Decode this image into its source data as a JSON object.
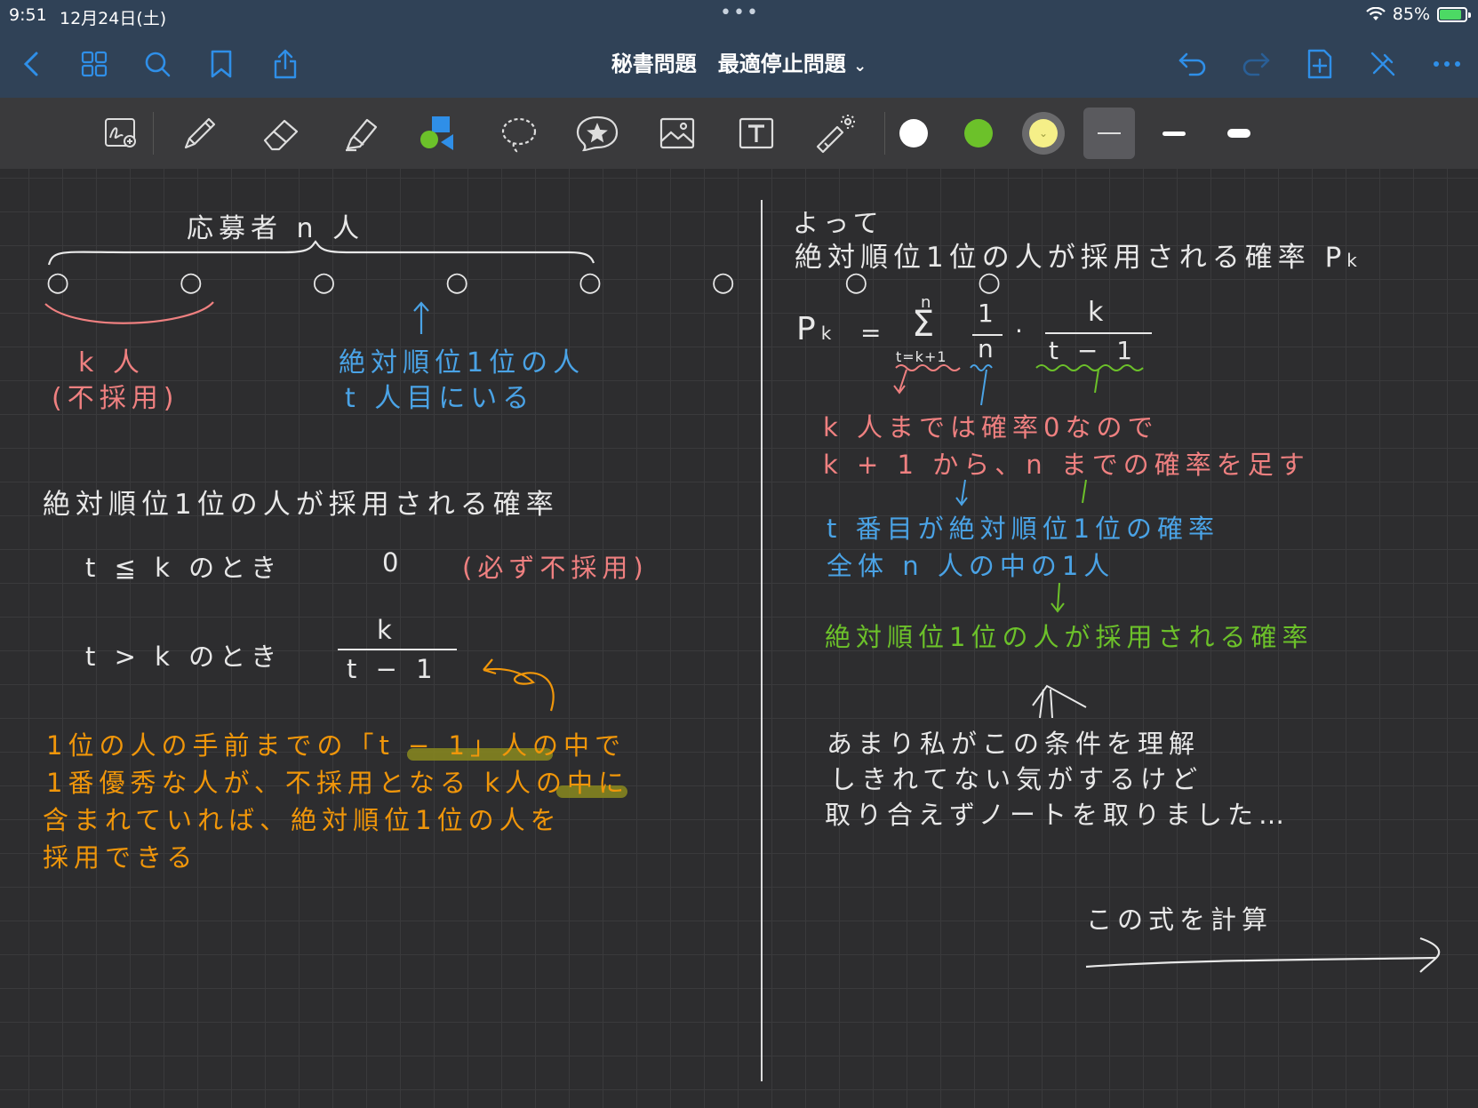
{
  "status": {
    "time": "9:51",
    "date": "12月24日(土)",
    "battery": "85%"
  },
  "nav": {
    "title": "秘書問題　最適停止問題",
    "title_chevron": "⌄"
  },
  "toolbar": {
    "colors": [
      "#ffffff",
      "#6cc12a",
      "#f5ef88"
    ]
  },
  "note": {
    "left": {
      "applicants": "応募者 n 人",
      "circles": "○ ○ ○ ○ ○ ○ ○ ○",
      "k_people": "k 人",
      "not_hired": "(不採用)",
      "best_person": "絶対順位1位の人",
      "tth": "t 人目にいる",
      "prob_heading": "絶対順位1位の人が採用される確率",
      "case1": "t ≦ k のとき",
      "case1_value": "0",
      "case1_note": "(必ず不採用)",
      "case2": "t > k のとき",
      "case2_num": "k",
      "case2_den": "t − 1",
      "explain": [
        "1位の人の手前までの「t − 1」人の中で",
        "1番優秀な人が、不採用となる k人の中に",
        "含まれていれば、絶対順位1位の人を",
        "採用できる"
      ]
    },
    "right": {
      "therefore": "よって",
      "heading": "絶対順位1位の人が採用される確率 P",
      "heading_sub": "k",
      "formula_p": "P",
      "formula_sub": "k",
      "formula_eq": "=",
      "sum_sym": "Σ",
      "sum_top": "n",
      "sum_bottom": "t=k+1",
      "frac1_num": "1",
      "frac1_den": "n",
      "dot": "·",
      "frac2_num": "k",
      "frac2_den": "t − 1",
      "note_red": [
        "k 人までは確率0なので",
        "k + 1 から、n までの確率を足す"
      ],
      "note_blue": [
        "t 番目が絶対順位1位の確率",
        "全体 n 人の中の1人"
      ],
      "note_green": "絶対順位1位の人が採用される確率",
      "comment": [
        "あまり私がこの条件を理解",
        "しきれてない気がするけど",
        "取り合えずノートを取りました…"
      ],
      "compute": "この式を計算"
    }
  }
}
